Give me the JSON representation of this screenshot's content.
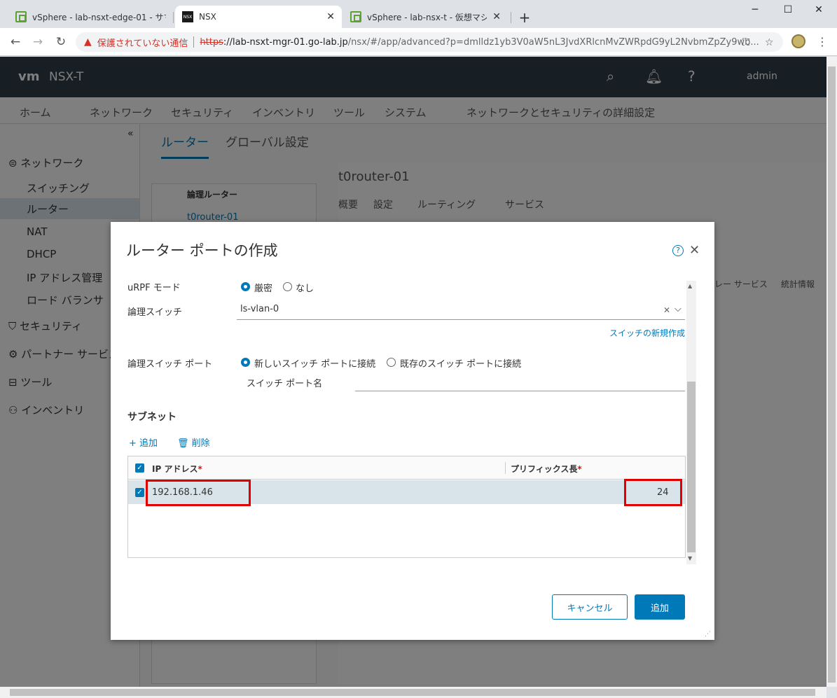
{
  "browser": {
    "tabs": [
      {
        "title": "vSphere - lab-nsxt-edge-01 - サマ",
        "favicon": "vsphere-icon"
      },
      {
        "title": "NSX",
        "favicon": "nsx-icon"
      },
      {
        "title": "vSphere - lab-nsx-t - 仮想マシン",
        "favicon": "vsphere-icon"
      }
    ],
    "nsx_favicon_text": "NSX",
    "close_glyph": "✕",
    "new_tab_glyph": "+",
    "security_label": "保護されていない通信",
    "url_scheme": "https",
    "url_host": "://lab-nsxt-mgr-01.go-lab.jp",
    "url_path": "/nsx/#/app/advanced?p=dmlldz1yb3V0aW5nL3JvdXRlcnMvZWRpdG9yL2NvbmZpZy9wb..."
  },
  "app": {
    "logo": "vm",
    "name": "NSX-T",
    "user": "admin",
    "topnav": [
      "ホーム",
      "ネットワーク",
      "セキュリティ",
      "インベントリ",
      "ツール",
      "システム",
      "ネットワークとセキュリティの詳細設定"
    ],
    "sidebar": {
      "collapse": "«",
      "group_network": "ネットワーク",
      "items": [
        "スイッチング",
        "ルーター",
        "NAT",
        "DHCP",
        "IP アドレス管理",
        "ロード バランサ"
      ],
      "group_security": "セキュリティ",
      "group_partner": "パートナー サービス",
      "group_tools": "ツール",
      "group_inventory": "インベントリ"
    },
    "subtabs": [
      "ルーター",
      "グローバル設定"
    ],
    "router_list_header": "論理ルーター",
    "router_list_item": "t0router-01",
    "detail_title": "t0router-01",
    "detail_tabs": [
      "概要",
      "設定",
      "ルーティング",
      "サービス"
    ],
    "detail_right_tabs": [
      "リレー サービス",
      "統計情報"
    ]
  },
  "modal": {
    "title": "ルーター ポートの作成",
    "urpf_label": "uRPF モード",
    "urpf_options": [
      "厳密",
      "なし"
    ],
    "logical_switch_label": "論理スイッチ",
    "logical_switch_value": "ls-vlan-0",
    "create_switch_link": "スイッチの新規作成",
    "switch_port_label": "論理スイッチ ポート",
    "switch_port_options": [
      "新しいスイッチ ポートに接続",
      "既存のスイッチ ポートに接続"
    ],
    "switch_port_name_label": "スイッチ ポート名",
    "switch_port_name_value": "",
    "subnet_section": "サブネット",
    "add_action": "追加",
    "delete_action": "削除",
    "grid": {
      "columns": [
        "IP アドレス",
        "プリフィックス長"
      ],
      "required_mark": "*",
      "rows": [
        {
          "ip": "192.168.1.46",
          "prefix": "24"
        }
      ]
    },
    "cancel_button": "キャンセル",
    "add_button": "追加"
  }
}
